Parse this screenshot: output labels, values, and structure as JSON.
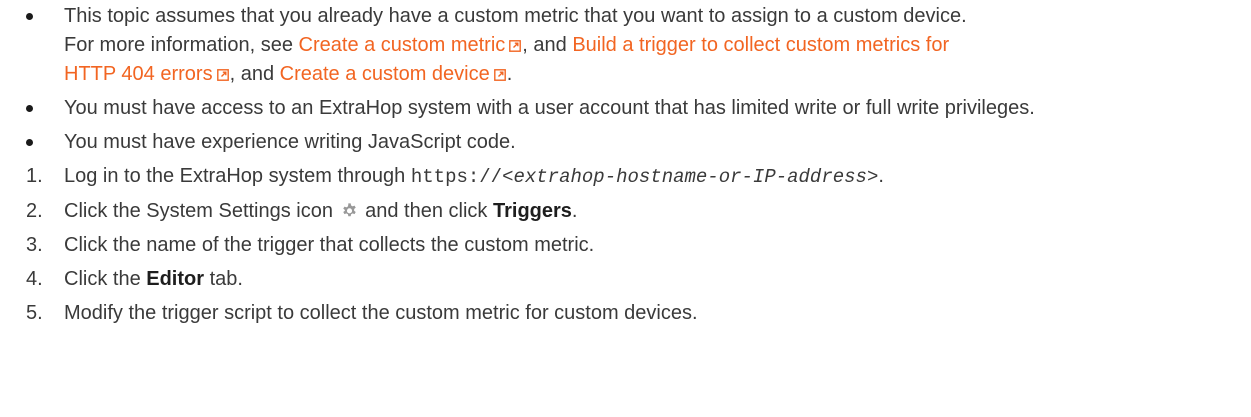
{
  "prerequisites": {
    "item1": {
      "line1": "This topic assumes that you already have a custom metric that you want to assign to a custom device.",
      "for_more": "For more information, see ",
      "link1": "Create a custom metric",
      "sep1": ", and ",
      "link2_part1": "Build a trigger to collect custom metrics for",
      "link2_part2": "HTTP 404 errors",
      "sep2": ", and ",
      "link3": "Create a custom device",
      "end": "."
    },
    "item2": "You must have access to an ExtraHop system with a user account that has limited write or full write privileges.",
    "item3": "You must have experience writing JavaScript code."
  },
  "steps": {
    "step1": {
      "num": "1.",
      "pre": "Log in to the ExtraHop system through ",
      "code_url": "https://",
      "code_placeholder": "<extrahop-hostname-or-IP-address>",
      "end": "."
    },
    "step2": {
      "num": "2.",
      "pre": "Click the System Settings icon",
      "mid": "and then click ",
      "bold": "Triggers",
      "end": "."
    },
    "step3": {
      "num": "3.",
      "text": "Click the name of the trigger that collects the custom metric."
    },
    "step4": {
      "num": "4.",
      "pre": "Click the ",
      "bold": "Editor",
      "end": " tab."
    },
    "step5": {
      "num": "5.",
      "text": "Modify the trigger script to collect the custom metric for custom devices."
    }
  },
  "icons": {
    "external_link": "external-link-icon",
    "settings": "gear-icon"
  },
  "colors": {
    "link": "#f26522",
    "text": "#3a3a3a",
    "icon_gray": "#999999"
  }
}
